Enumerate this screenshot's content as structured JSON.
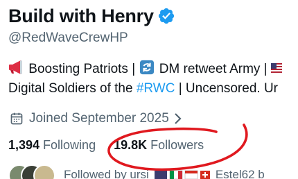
{
  "profile": {
    "display_name": "Build with Henry",
    "handle": "@RedWaveCrewHP",
    "bio_line1_text_a": "Boosting Patriots |",
    "bio_line1_text_b": "DM retweet Army |",
    "bio_line2_text_a": "Digital Soldiers of the",
    "bio_line2_hashtag": "#RWC",
    "bio_line2_text_b": "| Uncensored. Ur",
    "joined": "Joined September 2025"
  },
  "stats": {
    "following_count": "1,394",
    "following_label": "Following",
    "followers_count": "19.8K",
    "followers_label": "Followers"
  },
  "followed_by": {
    "text_a": "Followed by ursi",
    "text_b": "Estel62 b"
  },
  "icons": {
    "verified": "verified-badge-icon",
    "megaphone": "megaphone-icon",
    "repeat": "repeat-icon",
    "calendar": "calendar-icon",
    "chevron": "chevron-right-icon"
  },
  "colors": {
    "verified_blue": "#1d9bf0",
    "secondary_text": "#536471",
    "annotation_red": "#e0191f"
  }
}
